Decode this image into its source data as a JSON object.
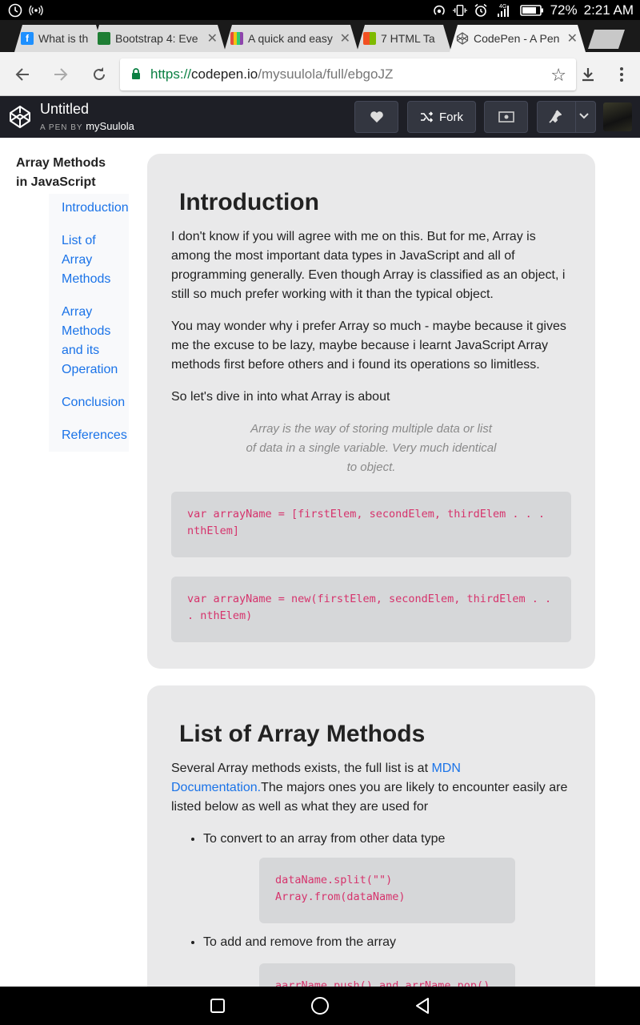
{
  "status_bar": {
    "battery": "72%",
    "time": "2:21 AM",
    "network": "4G"
  },
  "tabs": [
    {
      "title": "What is th",
      "favicon_color": "#1e90ff"
    },
    {
      "title": "Bootstrap 4: Eve",
      "favicon_color": "#1e7e34"
    },
    {
      "title": "A quick and easy",
      "favicon_color": "#8e44ad"
    },
    {
      "title": "7 HTML Ta",
      "favicon_color": "#e67e22"
    },
    {
      "title": "CodePen - A Pen",
      "favicon_color": "#555555"
    }
  ],
  "address_bar": {
    "scheme": "https://",
    "host": "codepen.io",
    "path": "/mysuulola/full/ebgoJZ"
  },
  "codepen": {
    "title": "Untitled",
    "by_label": "A PEN BY",
    "author": "mySuulola",
    "fork_label": "Fork"
  },
  "nav": {
    "title": "Array Methods in JavaScript",
    "items": [
      "Introduction",
      "List of Array Methods",
      "Array Methods and its Operation",
      "Conclusion",
      "References"
    ]
  },
  "sections": {
    "intro": {
      "heading": "Introduction",
      "p1": "I don't know if you will agree with me on this. But for me, Array is among the most important data types in JavaScript and all of programming generally. Even though Array is classified as an object, i still so much prefer working with it than the typical object.",
      "p2": "You may wonder why i prefer Array so much - maybe because it gives me the excuse to be lazy, maybe because i learnt JavaScript Array methods first before others and i found its operations so limitless.",
      "p3": "So let's dive in into what Array is about",
      "quote": "Array is the way of storing multiple data or list of data in a single variable. Very much identical to object.",
      "code1": "var arrayName = [firstElem, secondElem, thirdElem . . . nthElem]",
      "code2": "var arrayName = new(firstElem, secondElem, thirdElem . . . nthElem)"
    },
    "list": {
      "heading": "List of Array Methods",
      "p_before_link": "Several Array methods exists, the full list is at ",
      "link": "MDN Documentation.",
      "p_after_link": "The majors ones you are likely to encounter easily are listed below as well as what they are used for",
      "bullet1": "To convert to an array from other data type",
      "code3_line1": "dataName.split(\"\")",
      "code3_line2": "Array.from(dataName)",
      "bullet2": "To add and remove from the array",
      "code4_line1": "aarrName.push() and arrName.pop()"
    }
  }
}
